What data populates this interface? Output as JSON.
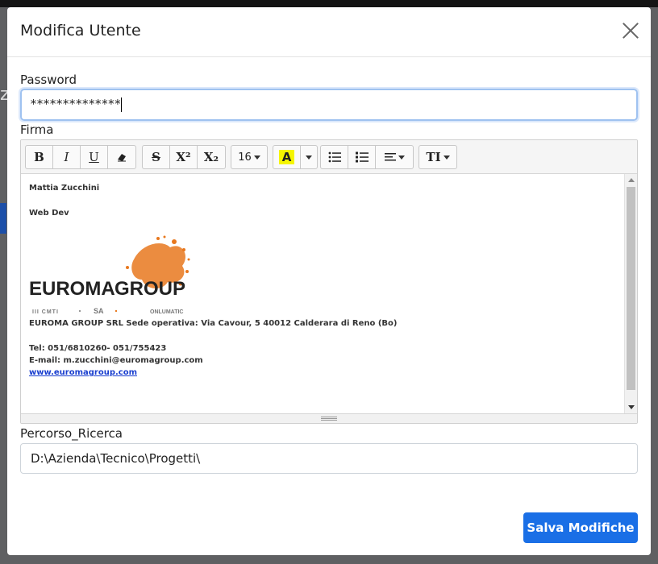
{
  "modal": {
    "title": "Modifica Utente"
  },
  "password": {
    "label": "Password",
    "value": "**************"
  },
  "firma": {
    "label": "Firma",
    "toolbar": {
      "bold": "B",
      "italic": "I",
      "underline": "U",
      "strike": "S",
      "superscript": "X²",
      "subscript": "X₂",
      "font_size": "16",
      "color_letter": "A",
      "text_size": "TI",
      "color_highlight": "#f5f500"
    },
    "signature": {
      "name": "Mattia Zucchini",
      "role": "Web Dev",
      "logo_text_bold": "EUROMA",
      "logo_text_light": "GROUP",
      "partners": [
        "III CMTI",
        "SA",
        "ONLUMATIC"
      ],
      "address": "EUROMA GROUP SRL Sede operativa: Via Cavour, 5 40012 Calderara di Reno (Bo)",
      "tel": "Tel: 051/6810260- 051/755423",
      "email": "E-mail: m.zucchini@euromagroup.com",
      "website": "www.euromagroup.com"
    }
  },
  "percorso": {
    "label": "Percorso_Ricerca",
    "value": "D:\\Azienda\\Tecnico\\Progetti\\"
  },
  "footer": {
    "save_label": "Salva Modifiche"
  },
  "colors": {
    "accent": "#1a6fe6",
    "logo_orange": "#e8781e"
  }
}
